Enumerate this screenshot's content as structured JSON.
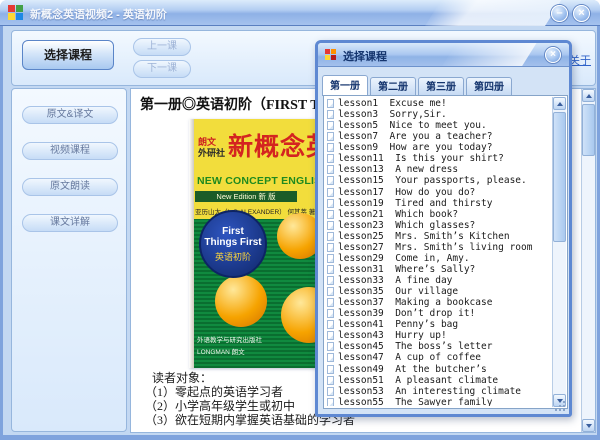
{
  "window": {
    "title": "新概念英语视频2 - 英语初阶",
    "controls": {
      "minimize": "–",
      "close": "×"
    }
  },
  "toolbar": {
    "select_course": "选择课程",
    "prev_lesson": "上一课",
    "next_lesson": "下一课",
    "about_link": "关于"
  },
  "sidebar": {
    "items": [
      {
        "label": "原文&译文"
      },
      {
        "label": "视频课程"
      },
      {
        "label": "原文朗读"
      },
      {
        "label": "课文详解"
      }
    ]
  },
  "main": {
    "heading": "第一册◎英语初阶（FIRST THI",
    "book_cover": {
      "publisher_top1": "朗文",
      "publisher_top2": "外研社",
      "title_cn": "新概念英",
      "title_en": "NEW CONCEPT ENGLIS",
      "edition": "New Edition 新  版",
      "authors": "亚历山大（L.G.ALEXANDER） 何其莘 著",
      "circle_line1": "First",
      "circle_line2": "Things First",
      "circle_line3": "英语初阶",
      "publisher_bottom1": "外语教学与研究出版社",
      "publisher_bottom2": "LONGMAN 朗文"
    },
    "reader": {
      "title": "读者对象：",
      "line1": "（1）零起点的英语学习者",
      "line2": "（2）小学高年级学生或初中",
      "line3": "（3）欲在短期内掌握英语基础的学习者"
    }
  },
  "dialog": {
    "title": "选择课程",
    "close": "×",
    "tabs": [
      {
        "label": "第一册",
        "active": true
      },
      {
        "label": "第二册",
        "active": false
      },
      {
        "label": "第三册",
        "active": false
      },
      {
        "label": "第四册",
        "active": false
      }
    ],
    "lessons": [
      {
        "id": "lesson1",
        "title": "Excuse me!"
      },
      {
        "id": "lesson3",
        "title": "Sorry,Sir."
      },
      {
        "id": "lesson5",
        "title": "Nice to meet you."
      },
      {
        "id": "lesson7",
        "title": "Are you a teacher?"
      },
      {
        "id": "lesson9",
        "title": "How are you today?"
      },
      {
        "id": "lesson11",
        "title": "Is this your shirt?"
      },
      {
        "id": "lesson13",
        "title": "A new dress"
      },
      {
        "id": "lesson15",
        "title": "Your passports, please."
      },
      {
        "id": "lesson17",
        "title": "How do you do?"
      },
      {
        "id": "lesson19",
        "title": "Tired and thirsty"
      },
      {
        "id": "lesson21",
        "title": "Which book?"
      },
      {
        "id": "lesson23",
        "title": "Which glasses?"
      },
      {
        "id": "lesson25",
        "title": "Mrs. Smith’s Kitchen"
      },
      {
        "id": "lesson27",
        "title": "Mrs. Smith’s living room"
      },
      {
        "id": "lesson29",
        "title": "Come in, Amy."
      },
      {
        "id": "lesson31",
        "title": "Where’s Sally?"
      },
      {
        "id": "lesson33",
        "title": "A fine day"
      },
      {
        "id": "lesson35",
        "title": "Our village"
      },
      {
        "id": "lesson37",
        "title": "Making a bookcase"
      },
      {
        "id": "lesson39",
        "title": "Don’t drop it!"
      },
      {
        "id": "lesson41",
        "title": "Penny’s bag"
      },
      {
        "id": "lesson43",
        "title": "Hurry up!"
      },
      {
        "id": "lesson45",
        "title": "The boss’s letter"
      },
      {
        "id": "lesson47",
        "title": "A cup of coffee"
      },
      {
        "id": "lesson49",
        "title": "At the butcher’s"
      },
      {
        "id": "lesson51",
        "title": "A pleasant climate"
      },
      {
        "id": "lesson53",
        "title": "An interesting climate"
      },
      {
        "id": "lesson55",
        "title": "The Sawyer family"
      }
    ]
  },
  "colors": {
    "titlebar_blue": "#8fb3e6",
    "window_bg": "#c3d8f2",
    "accent_border": "#5e88d2",
    "link_blue": "#2f62c9",
    "cover_yellow": "#f2dd3c",
    "cover_green": "#0d7d38",
    "cover_red": "#d42420",
    "cover_circle_blue": "#1d3f9b",
    "ball_orange": "#f6a300"
  }
}
